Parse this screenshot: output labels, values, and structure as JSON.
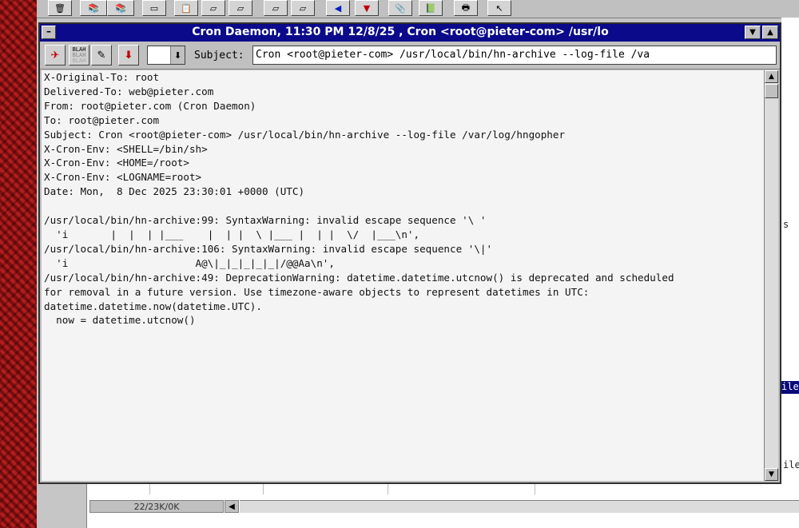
{
  "window": {
    "title": "Cron Daemon, 11:30 PM 12/8/25 , Cron <root@pieter-com> /usr/lo"
  },
  "toolbar": {
    "subject_label": "Subject:",
    "subject_value": "Cron <root@pieter-com> /usr/local/bin/hn-archive --log-file /va",
    "blah_label": "BLAH"
  },
  "message": {
    "lines": [
      "X-Original-To: root",
      "Delivered-To: web@pieter.com",
      "From: root@pieter.com (Cron Daemon)",
      "To: root@pieter.com",
      "Subject: Cron <root@pieter-com> /usr/local/bin/hn-archive --log-file /var/log/hngopher",
      "X-Cron-Env: <SHELL=/bin/sh>",
      "X-Cron-Env: <HOME=/root>",
      "X-Cron-Env: <LOGNAME=root>",
      "Date: Mon,  8 Dec 2025 23:30:01 +0000 (UTC)",
      "",
      "/usr/local/bin/hn-archive:99: SyntaxWarning: invalid escape sequence '\\ '",
      "  'i       |  |  | |___    |  | |  \\ |___ |  | |  \\/  |___\\n',",
      "/usr/local/bin/hn-archive:106: SyntaxWarning: invalid escape sequence '\\|'",
      "  'i                     A@\\|_|_|_|_|_|/@@Aa\\n',",
      "/usr/local/bin/hn-archive:49: DeprecationWarning: datetime.datetime.utcnow() is deprecated and scheduled",
      "for removal in a future version. Use timezone-aware objects to represent datetimes in UTC:",
      "datetime.datetime.now(datetime.UTC).",
      "  now = datetime.utcnow()"
    ]
  },
  "background": {
    "status_text": "22/23K/0K",
    "right_fragments": [
      "s",
      "ile",
      "ile"
    ]
  },
  "colors": {
    "titlebar": "#0a0a8a",
    "desktop": "#8a1010",
    "window": "#c0c0c0"
  }
}
